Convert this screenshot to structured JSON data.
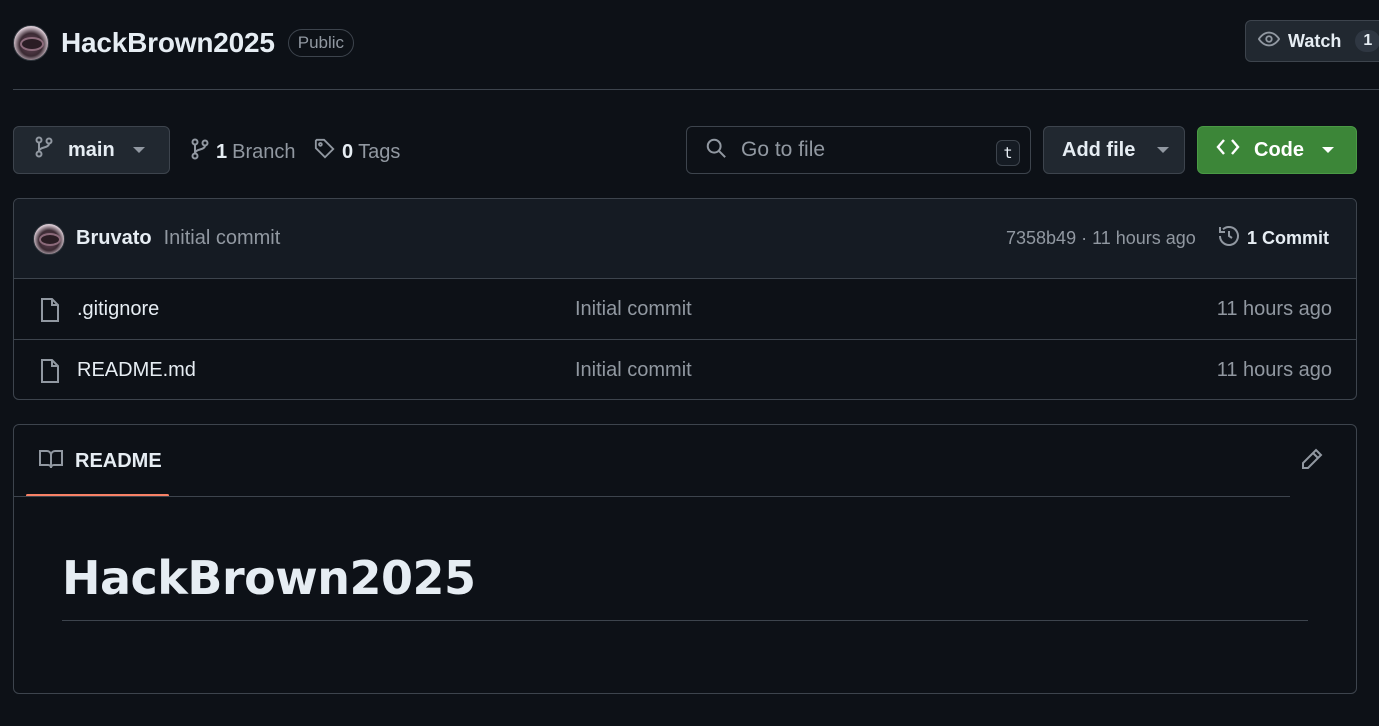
{
  "repo": {
    "name": "HackBrown2025",
    "visibility": "Public",
    "avatar_icon": "user-avatar"
  },
  "watch": {
    "label": "Watch",
    "count": "1",
    "icon": "eye-icon"
  },
  "toolbar": {
    "branch": "main",
    "branch_count": "1",
    "branch_label": "Branch",
    "tag_count": "0",
    "tag_label": "Tags",
    "search_placeholder": "Go to file",
    "search_shortcut": "t",
    "add_file_label": "Add file",
    "code_label": "Code"
  },
  "latest_commit": {
    "author": "Bruvato",
    "message": "Initial commit",
    "hash_time": "7358b49 · 11 hours ago",
    "count": "1",
    "count_label": "Commit"
  },
  "files": [
    {
      "name": ".gitignore",
      "message": "Initial commit",
      "time": "11 hours ago",
      "icon": "file-icon"
    },
    {
      "name": "README.md",
      "message": "Initial commit",
      "time": "11 hours ago",
      "icon": "file-icon"
    }
  ],
  "readme": {
    "tab_label": "README",
    "heading": "HackBrown2025"
  },
  "colors": {
    "background": "#0d1117",
    "border": "#3d444d",
    "code_button": "#3c8638",
    "tab_underline": "#f78166"
  }
}
